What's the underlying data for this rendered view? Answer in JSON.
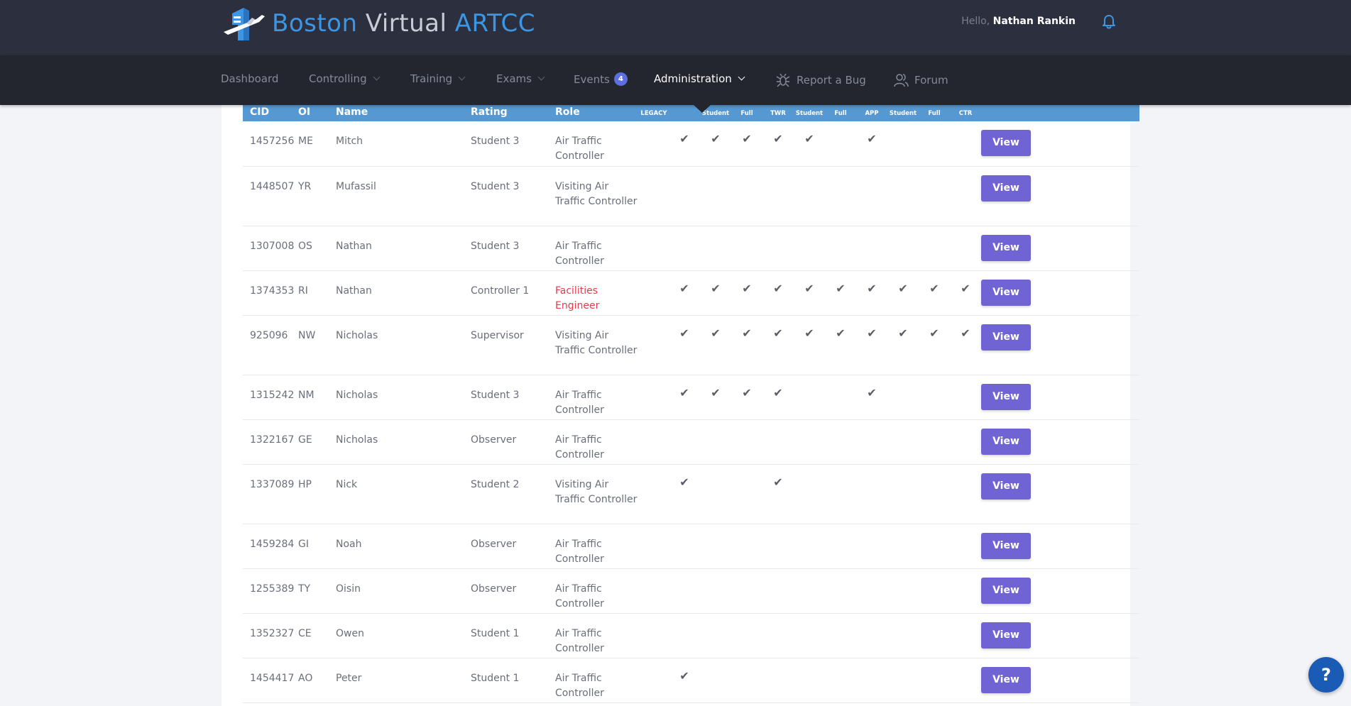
{
  "brand": {
    "boston": "Boston",
    "virtual": "Virtual",
    "artcc": "ARTCC"
  },
  "user": {
    "hello": "Hello,",
    "name": "Nathan Rankin"
  },
  "nav": {
    "dashboard": "Dashboard",
    "controlling": "Controlling",
    "training": "Training",
    "exams": "Exams",
    "events": "Events",
    "events_badge": "4",
    "administration": "Administration",
    "report_bug": "Report a Bug",
    "forum": "Forum"
  },
  "table": {
    "headers": {
      "cid": "CID",
      "oi": "OI",
      "name": "Name",
      "rating": "Rating",
      "role": "Role",
      "legacy": "LEGACY",
      "c1": "",
      "c2": "Student",
      "c3": "Full",
      "c4": "TWR",
      "c5": "Student",
      "c6": "Full",
      "c7": "APP",
      "c8": "Student",
      "c9": "Full",
      "c10": "CTR"
    },
    "view_label": "View",
    "rows": [
      {
        "cid": "1457256",
        "oi": "ME",
        "name": "Mitch",
        "rating": "Student 3",
        "role": "Air Traffic Controller"
      },
      {
        "cid": "1448507",
        "oi": "YR",
        "name": "Mufassil",
        "rating": "Student 3",
        "role": "Visiting Air Traffic Controller"
      },
      {
        "cid": "1307008",
        "oi": "OS",
        "name": "Nathan",
        "rating": "Student 3",
        "role": "Air Traffic Controller"
      },
      {
        "cid": "1374353",
        "oi": "RI",
        "name": "Nathan",
        "rating": "Controller 1",
        "role": "Facilities Engineer"
      },
      {
        "cid": "925096",
        "oi": "NW",
        "name": "Nicholas",
        "rating": "Supervisor",
        "role": "Visiting Air Traffic Controller"
      },
      {
        "cid": "1315242",
        "oi": "NM",
        "name": "Nicholas",
        "rating": "Student 3",
        "role": "Air Traffic Controller"
      },
      {
        "cid": "1322167",
        "oi": "GE",
        "name": "Nicholas",
        "rating": "Observer",
        "role": "Air Traffic Controller"
      },
      {
        "cid": "1337089",
        "oi": "HP",
        "name": "Nick",
        "rating": "Student 2",
        "role": "Visiting Air Traffic Controller"
      },
      {
        "cid": "1459284",
        "oi": "GI",
        "name": "Noah",
        "rating": "Observer",
        "role": "Air Traffic Controller"
      },
      {
        "cid": "1255389",
        "oi": "TY",
        "name": "Oisin",
        "rating": "Observer",
        "role": "Air Traffic Controller"
      },
      {
        "cid": "1352327",
        "oi": "CE",
        "name": "Owen",
        "rating": "Student 1",
        "role": "Air Traffic Controller"
      },
      {
        "cid": "1454417",
        "oi": "AO",
        "name": "Peter",
        "rating": "Student 1",
        "role": "Air Traffic Controller"
      }
    ]
  },
  "help": "?"
}
